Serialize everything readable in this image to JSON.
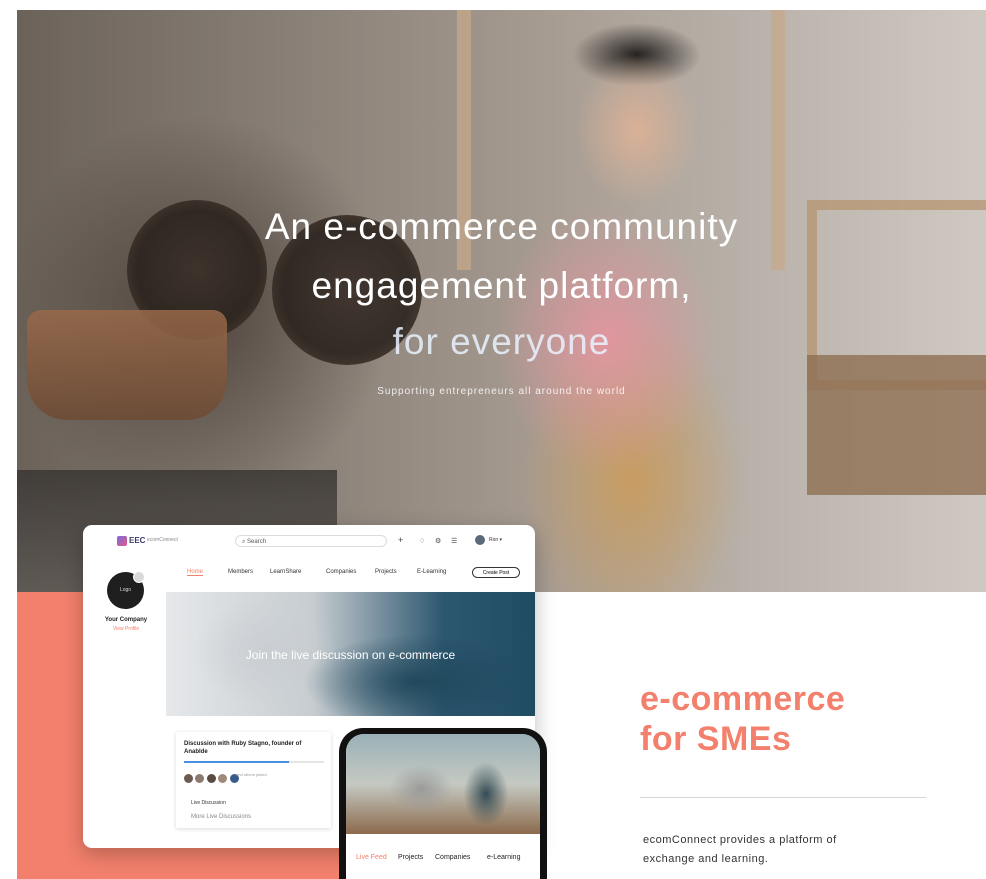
{
  "hero": {
    "headline_line1": "An e-commerce community",
    "headline_line2": "engagement platform,",
    "headline_line3": "for everyone",
    "subheadline": "Supporting entrepreneurs all around the world"
  },
  "desktop_mockup": {
    "logo_text": "EEC",
    "logo_sub": "ecomConnect",
    "search_placeholder": "Search",
    "toolbar_icons": [
      "plus-icon",
      "bell-icon",
      "gear-icon",
      "menu-icon"
    ],
    "user_label": "Ron ▾",
    "nav": [
      {
        "label": "Home",
        "active": true
      },
      {
        "label": "Members",
        "active": false
      },
      {
        "label": "LearnShare",
        "active": false
      },
      {
        "label": "Companies",
        "active": false
      },
      {
        "label": "Projects",
        "active": false
      },
      {
        "label": "E-Learning",
        "active": false
      }
    ],
    "nav_button": "Create Post",
    "company_logo_text": "Logo",
    "company_name": "Your Company",
    "company_link": "View Profile",
    "banner_text": "Join the live discussion on e-commerce",
    "card": {
      "title": "Discussion with Ruby Stagno, founder of Anablde",
      "progress_percent": 75,
      "participants_note": "and others joined",
      "live_label": "Live Discussion",
      "more_label": "More Live Discussions"
    }
  },
  "phone_mockup": {
    "nav": [
      {
        "label": "Live Feed",
        "active": true
      },
      {
        "label": "Projects",
        "active": false
      },
      {
        "label": "Companies",
        "active": false
      },
      {
        "label": "e-Learning",
        "active": false
      }
    ]
  },
  "feature": {
    "title_line1": "e-commerce",
    "title_line2": "for SMEs",
    "description_line1": "ecomConnect provides a platform of",
    "description_line2": "exchange and learning."
  },
  "colors": {
    "accent": "#f2806c",
    "text": "#333333"
  }
}
